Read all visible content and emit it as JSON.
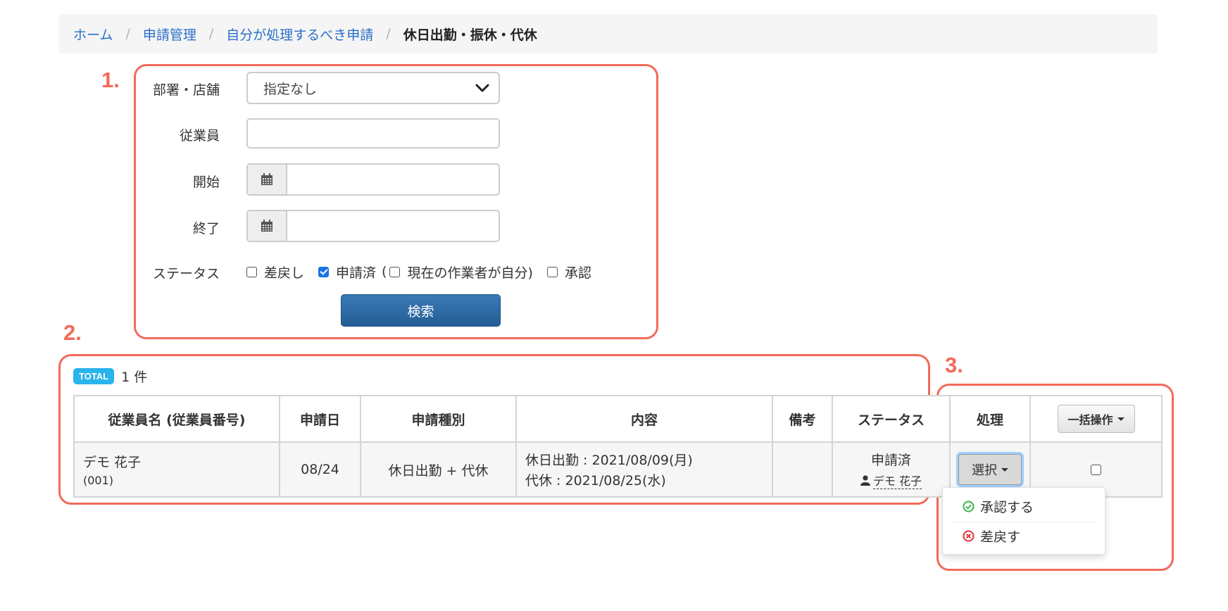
{
  "breadcrumb": {
    "items": [
      "ホーム",
      "申請管理",
      "自分が処理するべき申請"
    ],
    "current": "休日出勤・振休・代休",
    "separator": "/"
  },
  "annotations": [
    "1.",
    "2.",
    "3."
  ],
  "filter": {
    "department_label": "部署・店舗",
    "department_value": "指定なし",
    "employee_label": "従業員",
    "employee_value": "",
    "start_label": "開始",
    "start_value": "",
    "end_label": "終了",
    "end_value": "",
    "status_label": "ステータス",
    "status_options": {
      "returned": {
        "label": "差戻し",
        "checked": false
      },
      "applied": {
        "label": "申請済",
        "checked": true
      },
      "paren_open": "(",
      "mine": {
        "label": "現在の作業者が自分)",
        "checked": false
      },
      "approved": {
        "label": "承認",
        "checked": false
      }
    },
    "search_button": "検索"
  },
  "results": {
    "total_badge": "TOTAL",
    "total_count": "1 件"
  },
  "table": {
    "headers": {
      "employee": "従業員名 (従業員番号)",
      "date": "申請日",
      "type": "申請種別",
      "content": "内容",
      "note": "備考",
      "status": "ステータス",
      "action": "処理",
      "bulk": "一括操作"
    },
    "rows": [
      {
        "employee_name": "デモ 花子",
        "employee_no": "(001)",
        "date": "08/24",
        "type": "休日出勤 + 代休",
        "content_line1": "休日出勤 : 2021/08/09(月)",
        "content_line2": "代休 : 2021/08/25(水)",
        "note": "",
        "status": "申請済",
        "status_user": "デモ 花子",
        "action_button": "選択",
        "selected": false
      }
    ]
  },
  "action_menu": {
    "approve": "承認する",
    "return": "差戻す"
  },
  "colors": {
    "annotation": "#f26a5a",
    "link": "#2a6fc9",
    "primary_button": "#2d6ca8",
    "badge": "#2ab4ec",
    "approve_icon": "#3bb54a",
    "return_icon": "#e0343a"
  }
}
